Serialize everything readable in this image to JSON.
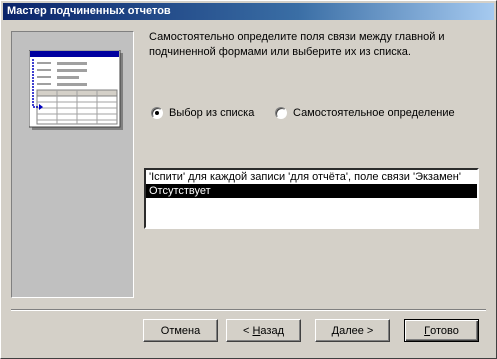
{
  "window": {
    "title": "Мастер подчиненных отчетов"
  },
  "preview": {
    "icon": "report-layout-preview"
  },
  "description": "Самостоятельно определите поля связи между главной и подчиненной формами или выберите их из списка.",
  "options": {
    "from_list": {
      "label": "Выбор из списка",
      "checked": true
    },
    "self_define": {
      "label": "Самостоятельное определение",
      "checked": false
    }
  },
  "link_list": {
    "items": [
      "'Іспити' для каждой записи 'для отчёта', поле связи 'Экзамен'",
      "Отсутствует"
    ],
    "selected_index": 1
  },
  "buttons": {
    "cancel": "Отмена",
    "back_prefix": "< ",
    "back_hotkey": "Н",
    "back_rest": "азад",
    "next_prefix": "",
    "next_hotkey": "Д",
    "next_rest": "алее >",
    "finish_prefix": "",
    "finish_hotkey": "Г",
    "finish_rest": "отово"
  }
}
